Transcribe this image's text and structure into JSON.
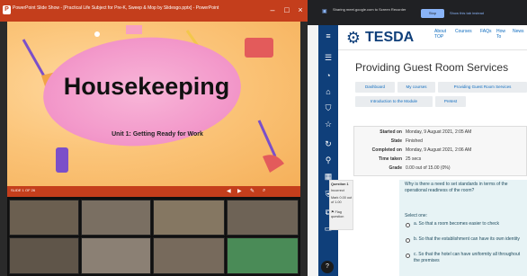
{
  "ppt": {
    "title": "PowerPoint Slide Show - [Practical Life Subject for Pre-K, Sweep & Mop by Slidesgo.pptx] - PowerPoint",
    "controls": {
      "minimize": "–",
      "restore": "□",
      "close": "×"
    },
    "slide_title": "Housekeeping",
    "slide_subtitle": "Unit 1: Getting Ready for Work",
    "status": "SLIDE 1 OF 26"
  },
  "meeting": {
    "participants": [
      {
        "name": ""
      },
      {
        "name": ""
      },
      {
        "name": ""
      },
      {
        "name": ""
      },
      {
        "name": ""
      },
      {
        "name": ""
      },
      {
        "name": ""
      },
      {
        "name": ""
      }
    ]
  },
  "share_bar": {
    "text": "Sharing meet.google.com to Screen Recorder",
    "stop_label": "Stop",
    "hide_label": "Show this tab instead"
  },
  "site": {
    "logo": "TESDA",
    "nav": [
      "About",
      "Courses",
      "FAQs",
      "How",
      "News"
    ],
    "nav_sub": [
      "TOP",
      "",
      "",
      "To",
      ""
    ]
  },
  "course": {
    "title": "Providing Guest Room Services",
    "breadcrumbs": [
      "Dashboard",
      "My courses",
      "Providing Guest Room Services"
    ],
    "breadcrumbs2": [
      "Introduction to the Module",
      "Pretest"
    ]
  },
  "summary": {
    "rows": [
      {
        "label": "Started on",
        "value": "Monday, 9 August 2021, 2:05 AM"
      },
      {
        "label": "State",
        "value": "Finished"
      },
      {
        "label": "Completed on",
        "value": "Monday, 9 August 2021, 2:06 AM"
      },
      {
        "label": "Time taken",
        "value": "25 secs"
      },
      {
        "label": "Grade",
        "value": "0.00 out of 15.00 (0%)"
      }
    ]
  },
  "question": {
    "info": [
      "Question 1",
      "Incorrect",
      "Mark 0.00 out",
      "of 1.00",
      "Flag",
      "question"
    ],
    "text": "Why is there a need to set standards in terms of the operational readiness of the room?",
    "select_label": "Select one:",
    "options": [
      "a.  So that a room becomes easier to check",
      "b.  So that the establishment can have its own identity",
      "c.  So that the hotel can have uniformity all throughout the premises"
    ]
  },
  "colors": {
    "ppt_brand": "#c43e1c",
    "moodle_primary": "#0f3f7a",
    "link": "#0f6cbf"
  }
}
